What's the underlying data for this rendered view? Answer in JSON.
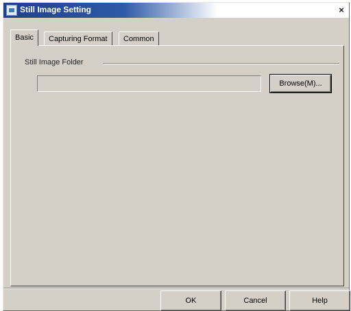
{
  "window": {
    "title": "Still Image Setting",
    "close_label": "×"
  },
  "tabs": [
    {
      "label": "Basic",
      "active": true
    },
    {
      "label": "Capturing Format",
      "active": false
    },
    {
      "label": "Common",
      "active": false
    }
  ],
  "basic": {
    "group_label": "Still Image Folder",
    "folder_value": "",
    "browse_label": "Browse(M)..."
  },
  "footer": {
    "ok_label": "OK",
    "cancel_label": "Cancel",
    "help_label": "Help"
  }
}
